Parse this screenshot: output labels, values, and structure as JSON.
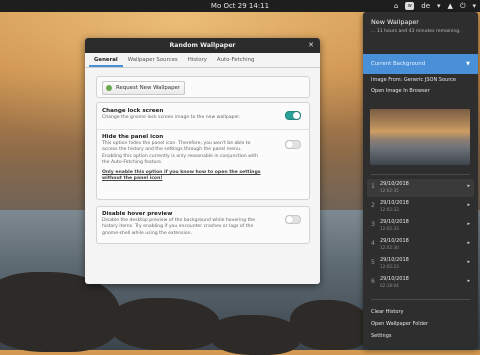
{
  "topbar": {
    "clock": "Mo Oct 29  14:11",
    "wallpaper_indicator": "w",
    "keyboard_layout": "de"
  },
  "window": {
    "title": "Random Wallpaper",
    "close_icon": "close-icon",
    "tabs": [
      "General",
      "Wallpaper Sources",
      "History",
      "Auto-Fetching"
    ],
    "active_tab": "General",
    "request_button": "Request New Wallpaper",
    "settings": [
      {
        "title": "Change lock screen",
        "desc": "Change the gnome lock screen image to the new wallpaper.",
        "enabled": true
      },
      {
        "title": "Hide the panel icon",
        "desc": "This option hides the panel icon. Therefore, you won't be able to access the history and the settings through the panel menu. Enabling this option currently is only reasonable in conjunction with the Auto-Fetching feature.",
        "warning": "Only enable this option if you know how to open the settings without the panel icon!",
        "enabled": false
      },
      {
        "title": "Disable hover preview",
        "desc": "Disable the desktop preview of the background while hovering the history items. Try enabling if you encounter crashes or lags of the gnome-shell while using the extension.",
        "enabled": false
      }
    ]
  },
  "menu": {
    "title": "New Wallpaper",
    "subtitle": "... 11 hours and 43 minutes remaining.",
    "current_background": "Current Background",
    "image_from": "Image From: Generic JSON Source",
    "open_in_browser": "Open Image In Browser",
    "history": [
      {
        "num": "1",
        "date": "29/10/2018",
        "time": "12:02:35"
      },
      {
        "num": "2",
        "date": "29/10/2018",
        "time": "12:02:33"
      },
      {
        "num": "3",
        "date": "29/10/2018",
        "time": "12:02:33"
      },
      {
        "num": "4",
        "date": "29/10/2018",
        "time": "12:02:30"
      },
      {
        "num": "5",
        "date": "29/10/2018",
        "time": "12:02:23"
      },
      {
        "num": "6",
        "date": "29/10/2018",
        "time": "02:18:04"
      }
    ],
    "clear_history": "Clear History",
    "open_folder": "Open Wallpaper Folder",
    "settings": "Settings"
  }
}
